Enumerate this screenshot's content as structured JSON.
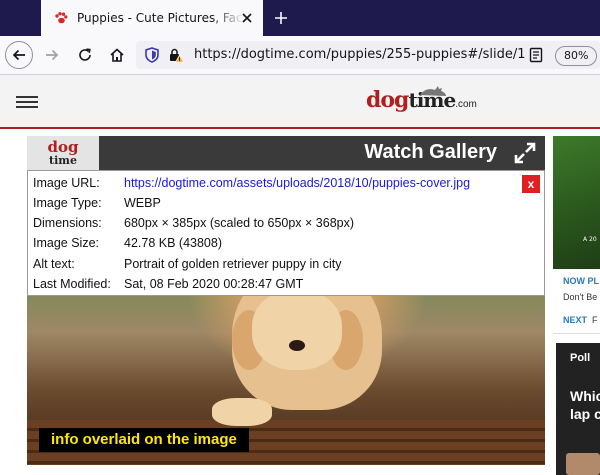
{
  "browser": {
    "tab": {
      "title": "Puppies - Cute Pictures, Facts, and Information"
    },
    "url": "https://dogtime.com/puppies/255-puppies#/slide/1",
    "zoom": "80%"
  },
  "site": {
    "logo": {
      "dog": "dog",
      "time": "time",
      "com": ".com"
    }
  },
  "gallery": {
    "logo": {
      "dog": "dog",
      "time": "time"
    },
    "watch_label": "Watch Gallery",
    "overlay_caption": "info overlaid on the image"
  },
  "image_info": {
    "close_label": "x",
    "rows": [
      {
        "key": "Image URL:",
        "value": "https://dogtime.com/assets/uploads/2018/10/puppies-cover.jpg"
      },
      {
        "key": "Image Type:",
        "value": "WEBP"
      },
      {
        "key": "Dimensions:",
        "value": "680px × 385px (scaled to 650px × 368px)"
      },
      {
        "key": "Image Size:",
        "value": "42.78 KB (43808)"
      },
      {
        "key": "Alt text:",
        "value": "Portrait of golden retriever puppy in city"
      },
      {
        "key": "Last Modified:",
        "value": "Sat, 08 Feb 2020 00:28:47 GMT"
      }
    ]
  },
  "rail": {
    "ad_text": "A 20",
    "now_playing": "NOW PL",
    "now_sub": "Don't Be",
    "next_label": "NEXT",
    "next_sub": "F",
    "poll_label": "Poll",
    "poll_line1": "Whic",
    "poll_line2": "lap c"
  },
  "colors": {
    "tabstrip": "#1e1a4d",
    "brand_red": "#b01e1e",
    "link_blue": "#1a1ad6",
    "caption_yellow": "#ffe800",
    "close_red": "#e02020"
  }
}
